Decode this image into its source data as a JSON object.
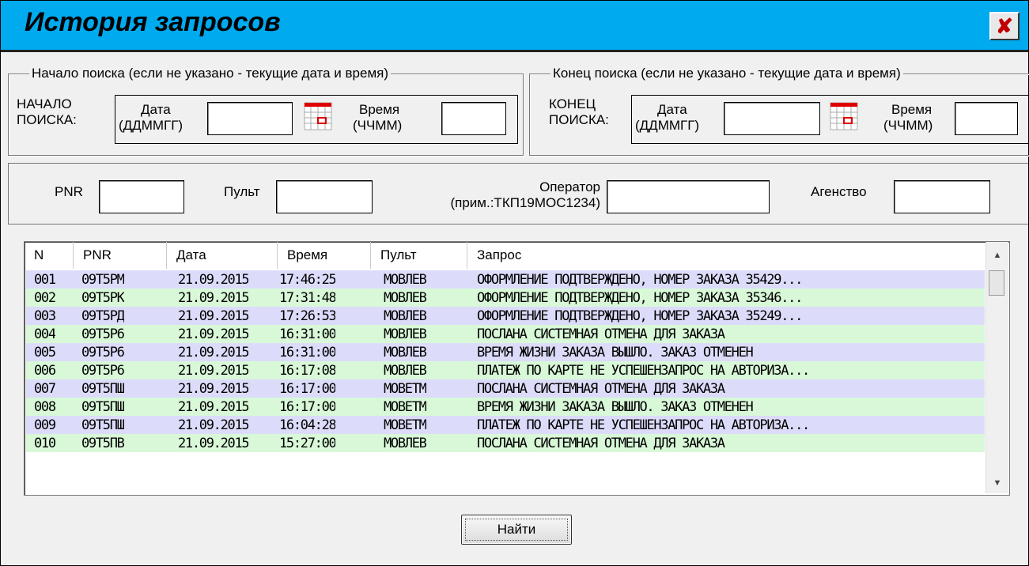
{
  "window": {
    "title": "История запросов",
    "close_glyph": "✘"
  },
  "start": {
    "legend": "Начало поиска (если не указано - текущие дата и время)",
    "label_line1": "НАЧАЛО",
    "label_line2": "ПОИСКА:",
    "date_label_line1": "Дата",
    "date_label_line2": "(ДДММГГ)",
    "date_value": "",
    "time_label_line1": "Время",
    "time_label_line2": "(ЧЧММ)",
    "time_value": ""
  },
  "end": {
    "legend": "Конец поиска (если не указано - текущие дата и время)",
    "label_line1": "КОНЕЦ",
    "label_line2": "ПОИСКА:",
    "date_label_line1": "Дата",
    "date_label_line2": "(ДДММГГ)",
    "date_value": "",
    "time_label_line1": "Время",
    "time_label_line2": "(ЧЧММ)",
    "time_value": ""
  },
  "filters": {
    "pnr_label": "PNR",
    "pnr_value": "",
    "pult_label": "Пульт",
    "pult_value": "",
    "operator_label_line1": "Оператор",
    "operator_label_line2": "(прим.:ТКП19МОС1234)",
    "operator_value": "",
    "agency_label": "Агенство",
    "agency_value": ""
  },
  "table": {
    "columns": [
      "N",
      "PNR",
      "Дата",
      "Время",
      "Пульт",
      "Запрос"
    ],
    "rows": [
      {
        "n": "001",
        "pnr": "09Т5РМ",
        "date": "21.09.2015",
        "time": "17:46:25",
        "pult": "МОВЛЕВ",
        "request": "ОФОРМЛЕНИЕ ПОДТВЕРЖДЕНО, НОМЕР ЗАКАЗА 35429..."
      },
      {
        "n": "002",
        "pnr": "09Т5РК",
        "date": "21.09.2015",
        "time": "17:31:48",
        "pult": "МОВЛЕВ",
        "request": "ОФОРМЛЕНИЕ ПОДТВЕРЖДЕНО, НОМЕР ЗАКАЗА 35346..."
      },
      {
        "n": "003",
        "pnr": "09Т5РД",
        "date": "21.09.2015",
        "time": "17:26:53",
        "pult": "МОВЛЕВ",
        "request": "ОФОРМЛЕНИЕ ПОДТВЕРЖДЕНО, НОМЕР ЗАКАЗА 35249..."
      },
      {
        "n": "004",
        "pnr": "09Т5Р6",
        "date": "21.09.2015",
        "time": "16:31:00",
        "pult": "МОВЛЕВ",
        "request": "ПОСЛАНА СИСТЕМНАЯ ОТМЕНА ДЛЯ ЗАКАЗА"
      },
      {
        "n": "005",
        "pnr": "09Т5Р6",
        "date": "21.09.2015",
        "time": "16:31:00",
        "pult": "МОВЛЕВ",
        "request": "ВРЕМЯ ЖИЗНИ ЗАКАЗА ВЫШЛО. ЗАКАЗ ОТМЕНЕН"
      },
      {
        "n": "006",
        "pnr": "09Т5Р6",
        "date": "21.09.2015",
        "time": "16:17:08",
        "pult": "МОВЛЕВ",
        "request": "ПЛАТЕЖ ПО КАРТЕ НЕ УСПЕШЕНЗАПРОС НА АВТОРИЗА..."
      },
      {
        "n": "007",
        "pnr": "09Т5ПШ",
        "date": "21.09.2015",
        "time": "16:17:00",
        "pult": "МОВЕТМ",
        "request": "ПОСЛАНА СИСТЕМНАЯ ОТМЕНА ДЛЯ ЗАКАЗА"
      },
      {
        "n": "008",
        "pnr": "09Т5ПШ",
        "date": "21.09.2015",
        "time": "16:17:00",
        "pult": "МОВЕТМ",
        "request": "ВРЕМЯ ЖИЗНИ ЗАКАЗА ВЫШЛО. ЗАКАЗ ОТМЕНЕН"
      },
      {
        "n": "009",
        "pnr": "09Т5ПШ",
        "date": "21.09.2015",
        "time": "16:04:28",
        "pult": "МОВЕТМ",
        "request": "ПЛАТЕЖ ПО КАРТЕ НЕ УСПЕШЕНЗАПРОС НА АВТОРИЗА..."
      },
      {
        "n": "010",
        "pnr": "09Т5ПВ",
        "date": "21.09.2015",
        "time": "15:27:00",
        "pult": "МОВЛЕВ",
        "request": "ПОСЛАНА СИСТЕМНАЯ ОТМЕНА ДЛЯ ЗАКАЗА"
      }
    ],
    "row_colors": [
      "#dcdcfa",
      "#d8f8d8"
    ]
  },
  "find_button": {
    "label": "Найти"
  },
  "colors": {
    "titlebar": "#00aaef",
    "close_x": "#c00000"
  },
  "icons": {
    "close": "close-icon",
    "calendar": "calendar-icon",
    "scroll_up": "scroll-up-icon",
    "scroll_down": "scroll-down-icon"
  }
}
